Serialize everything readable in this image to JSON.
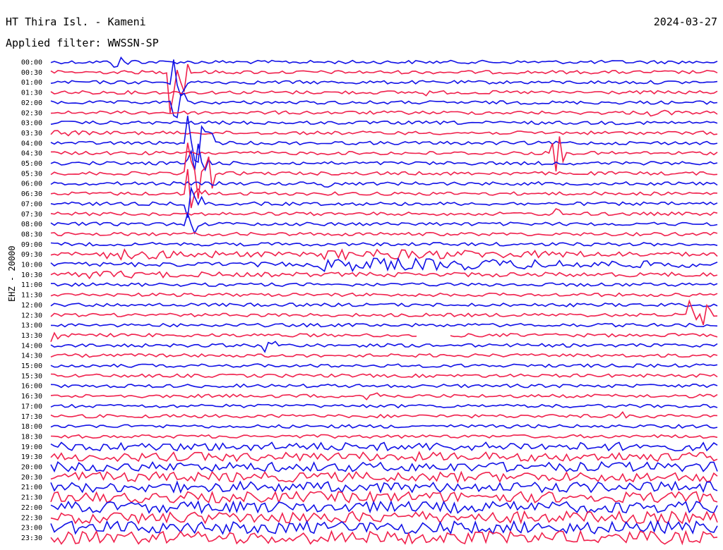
{
  "header": {
    "station": "HT Thira Isl. - Kameni",
    "date": "2024-03-27",
    "filter": "Applied filter: WWSSN-SP"
  },
  "channel_label": "EHZ - 20000",
  "colors": {
    "a": "#1010e6",
    "b": "#f0204c",
    "background": "#ffffff"
  },
  "time_labels": [
    "00:00",
    "00:30",
    "01:00",
    "01:30",
    "02:00",
    "02:30",
    "03:00",
    "03:30",
    "04:00",
    "04:30",
    "05:00",
    "05:30",
    "06:00",
    "06:30",
    "07:00",
    "07:30",
    "08:00",
    "08:30",
    "09:00",
    "09:30",
    "10:00",
    "10:30",
    "11:00",
    "11:30",
    "12:00",
    "12:30",
    "13:00",
    "13:30",
    "14:00",
    "14:30",
    "15:00",
    "15:30",
    "16:00",
    "16:30",
    "17:00",
    "17:30",
    "18:00",
    "18:30",
    "19:00",
    "19:30",
    "20:00",
    "20:30",
    "21:00",
    "21:30",
    "22:00",
    "22:30",
    "23:00",
    "23:30"
  ]
}
